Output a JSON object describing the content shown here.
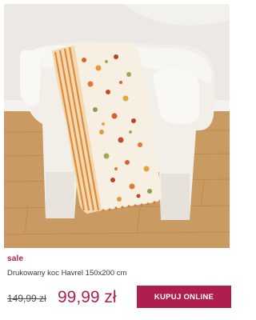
{
  "product": {
    "image_alt": "",
    "badge": "sale",
    "name": "Drukowany koc Havrel 150x200 cm",
    "old_price": "149,99 zł",
    "new_price": "99,99 zł",
    "buy_label": "KUPUJ ONLINE"
  },
  "colors": {
    "accent": "#ae1f4e",
    "sale_text": "#b01f4f"
  }
}
